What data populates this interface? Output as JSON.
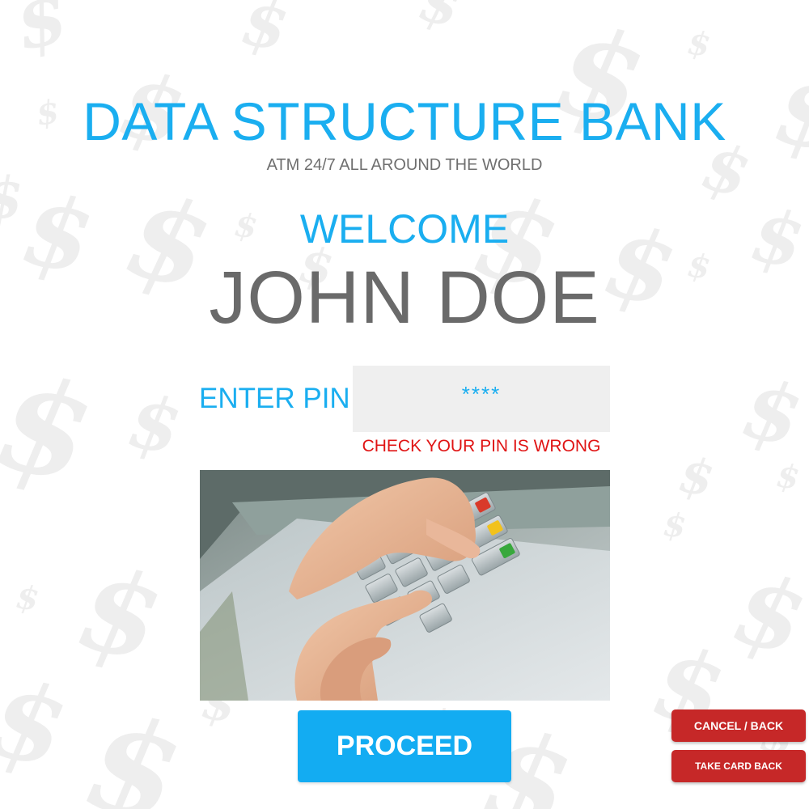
{
  "header": {
    "bank_name": "DATA STRUCTURE BANK",
    "tagline": "ATM 24/7 ALL AROUND THE WORLD"
  },
  "greeting": {
    "welcome": "WELCOME",
    "user_name": "JOHN DOE"
  },
  "pin": {
    "label": "ENTER PIN",
    "value": "****",
    "error": "CHECK YOUR PIN IS WRONG"
  },
  "actions": {
    "proceed_label": "PROCEED",
    "cancel_label": "CANCEL / BACK",
    "take_card_label": "TAKE CARD BACK"
  },
  "background": {
    "pattern_glyph": "$"
  },
  "colors": {
    "accent": "#1aaef0",
    "text_gray": "#6a6a6a",
    "error": "#e01414",
    "danger_button": "#c62828",
    "input_bg": "#efefef"
  }
}
